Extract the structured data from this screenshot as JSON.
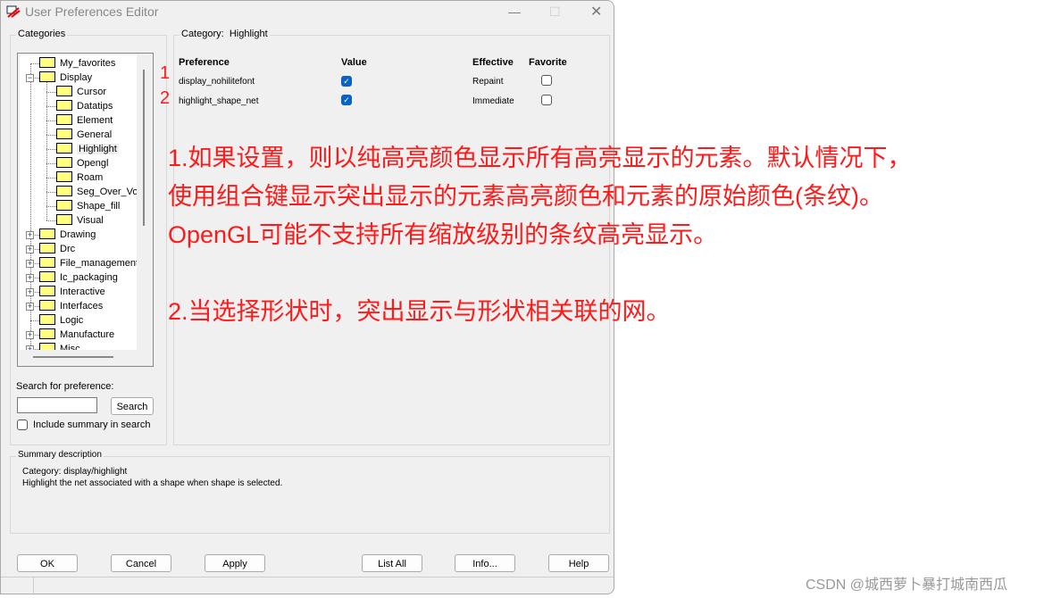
{
  "window": {
    "title": "User Preferences Editor",
    "controls": [
      "minimize",
      "maximize",
      "close"
    ]
  },
  "categories": {
    "label": "Categories",
    "tree": [
      {
        "label": "My_favorites",
        "level": 0,
        "expander": "none"
      },
      {
        "label": "Display",
        "level": 0,
        "expander": "minus"
      },
      {
        "label": "Cursor",
        "level": 1
      },
      {
        "label": "Datatips",
        "level": 1
      },
      {
        "label": "Element",
        "level": 1
      },
      {
        "label": "General",
        "level": 1
      },
      {
        "label": "Highlight",
        "level": 1,
        "selected": true
      },
      {
        "label": "Opengl",
        "level": 1
      },
      {
        "label": "Roam",
        "level": 1
      },
      {
        "label": "Seg_Over_Voi",
        "level": 1
      },
      {
        "label": "Shape_fill",
        "level": 1
      },
      {
        "label": "Visual",
        "level": 1
      },
      {
        "label": "Drawing",
        "level": 0,
        "expander": "plus"
      },
      {
        "label": "Drc",
        "level": 0,
        "expander": "plus"
      },
      {
        "label": "File_management",
        "level": 0,
        "expander": "plus"
      },
      {
        "label": "Ic_packaging",
        "level": 0,
        "expander": "plus"
      },
      {
        "label": "Interactive",
        "level": 0,
        "expander": "plus"
      },
      {
        "label": "Interfaces",
        "level": 0,
        "expander": "plus"
      },
      {
        "label": "Logic",
        "level": 0,
        "expander": "none"
      },
      {
        "label": "Manufacture",
        "level": 0,
        "expander": "plus"
      },
      {
        "label": "Misc",
        "level": 0,
        "expander": "plus"
      }
    ]
  },
  "search": {
    "label": "Search for preference:",
    "value": "",
    "button": "Search",
    "include_summary": "Include summary in search",
    "include_checked": false
  },
  "category_panel": {
    "label": "Category:",
    "category": "Highlight",
    "headers": {
      "preference": "Preference",
      "value": "Value",
      "effective": "Effective",
      "favorite": "Favorite"
    },
    "rows": [
      {
        "name": "display_nohilitefont",
        "value": true,
        "effective": "Repaint",
        "favorite": false
      },
      {
        "name": "highlight_shape_net",
        "value": true,
        "effective": "Immediate",
        "favorite": false
      }
    ]
  },
  "summary": {
    "label": "Summary description",
    "category": "Category: display/highlight",
    "text": "Highlight the net associated with a shape when shape is selected."
  },
  "buttons": {
    "ok": "OK",
    "cancel": "Cancel",
    "apply": "Apply",
    "list_all": "List All",
    "info": "Info...",
    "help": "Help"
  },
  "annotations": {
    "n1": "1",
    "n2": "2",
    "lines": [
      "1.如果设置，则以纯高亮颜色显示所有高亮显示的元素。默认情况下，",
      "使用组合键显示突出显示的元素高亮颜色和元素的原始颜色(条纹)。",
      "OpenGL可能不支持所有缩放级别的条纹高亮显示。",
      "2.当选择形状时，突出显示与形状相关联的网。"
    ],
    "color": "#ff1a1a"
  },
  "watermark": "CSDN @城西萝卜暴打城南西瓜"
}
